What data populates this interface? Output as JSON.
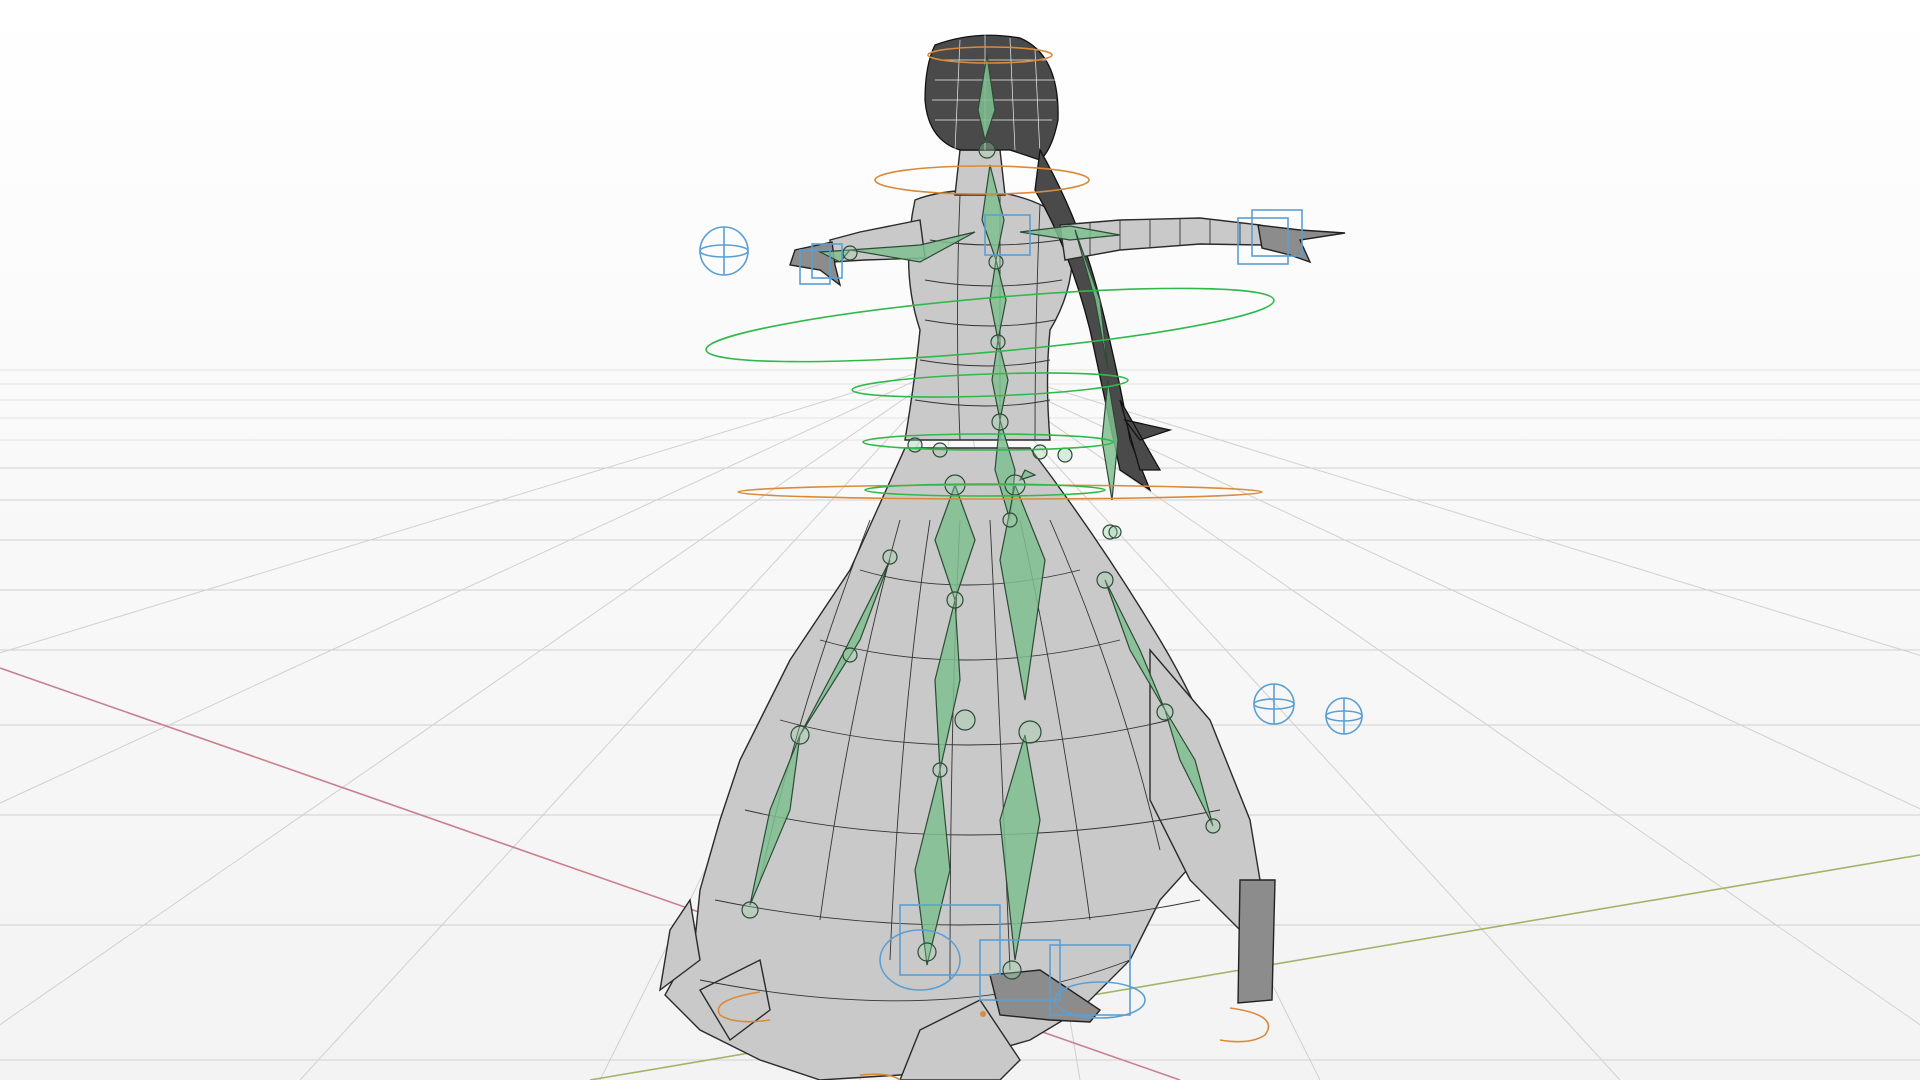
{
  "scene": {
    "viewport": "perspective",
    "background": "#ffffff",
    "grid": true,
    "axis_colors": {
      "x": "#c9808f",
      "y": "#9fb56a"
    },
    "mesh_color": "#c9c9c9",
    "bone_color": "#7fbf8f",
    "control_colors": {
      "green": "#31b84a",
      "orange": "#d98a3a",
      "blue": "#5a9fd4"
    },
    "objects": [
      {
        "name": "character-mesh",
        "shading": "wireframe-on-shaded"
      },
      {
        "name": "armature",
        "display": "octahedral"
      },
      {
        "name": "rig-controls"
      }
    ]
  }
}
